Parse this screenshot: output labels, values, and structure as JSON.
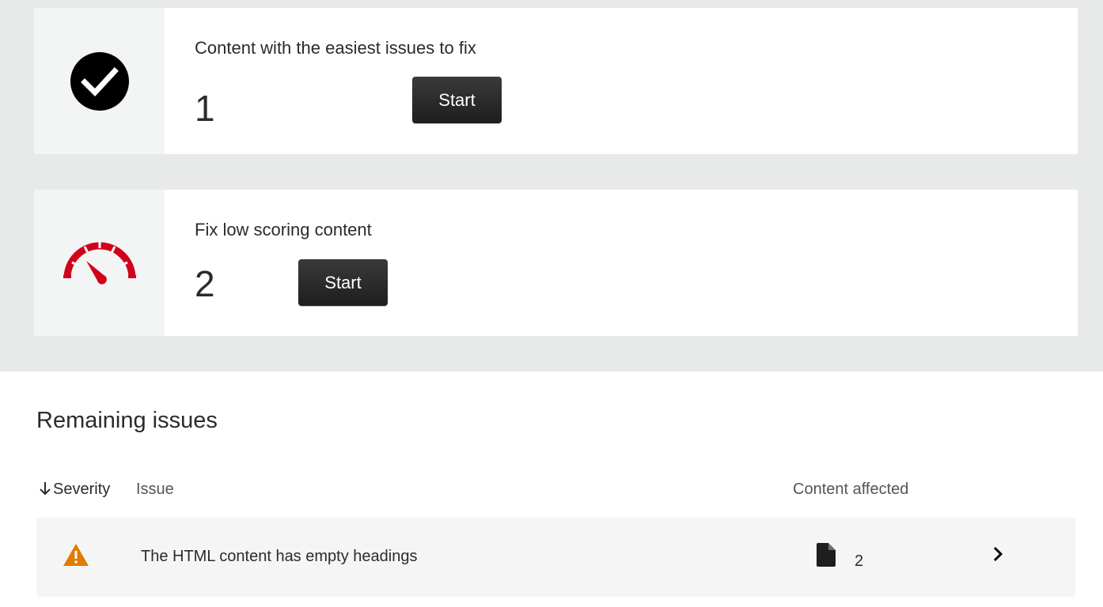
{
  "cards": [
    {
      "icon": "checkmark-circle-icon",
      "title": "Content with the easiest issues to fix",
      "count": "1",
      "button_label": "Start"
    },
    {
      "icon": "speedometer-icon",
      "title": "Fix low scoring content",
      "count": "2",
      "button_label": "Start",
      "accent_color": "#d0021b"
    }
  ],
  "remaining": {
    "title": "Remaining issues",
    "columns": {
      "severity": "Severity",
      "issue": "Issue",
      "content_affected": "Content affected"
    },
    "sort_icon": "arrow-down-icon",
    "rows": [
      {
        "severity_icon": "warning-icon",
        "severity_color": "#e07c00",
        "issue": "The HTML content has empty headings",
        "affected_icon": "document-icon",
        "affected": "2",
        "action_icon": "chevron-right-icon"
      }
    ]
  }
}
